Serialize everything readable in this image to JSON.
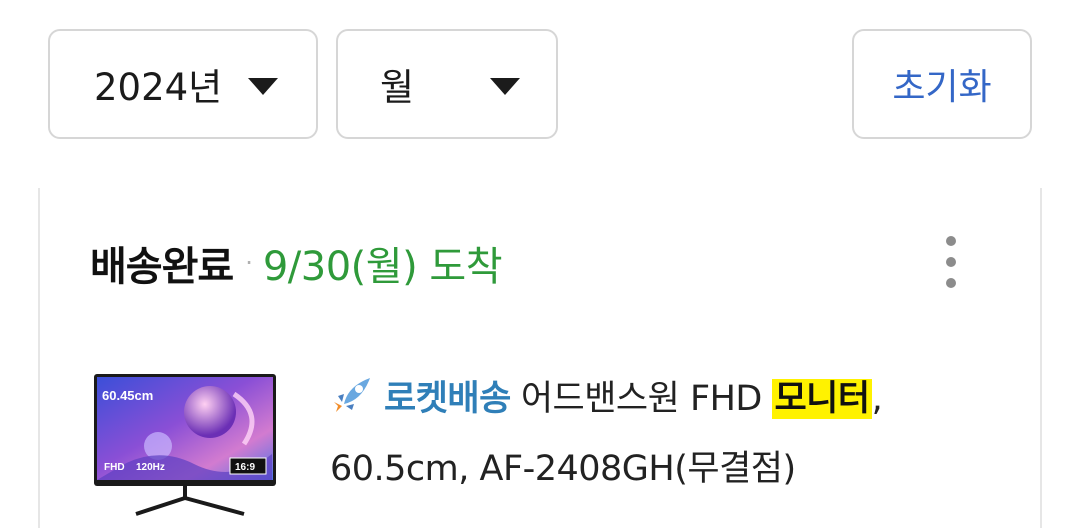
{
  "filters": {
    "year": "2024년",
    "month": "월",
    "reset": "초기화"
  },
  "order": {
    "status": "배송완료",
    "separator": "·",
    "arrival": "9/30(월) 도착",
    "product": {
      "badge": "로켓배송",
      "title_before": "어드밴스원 FHD ",
      "title_highlight": "모니터",
      "title_after": ",",
      "title_line2": "60.5cm, AF-2408GH(무결점)",
      "thumbnail_texts": {
        "size": "60.45cm",
        "fhd": "FHD",
        "hz": "120Hz",
        "ratio": "16:9"
      }
    }
  },
  "colors": {
    "arrival": "#2f9a3a",
    "reset": "#3467c7",
    "rocket_label": "#2f7fb8",
    "highlight": "#fff200"
  }
}
